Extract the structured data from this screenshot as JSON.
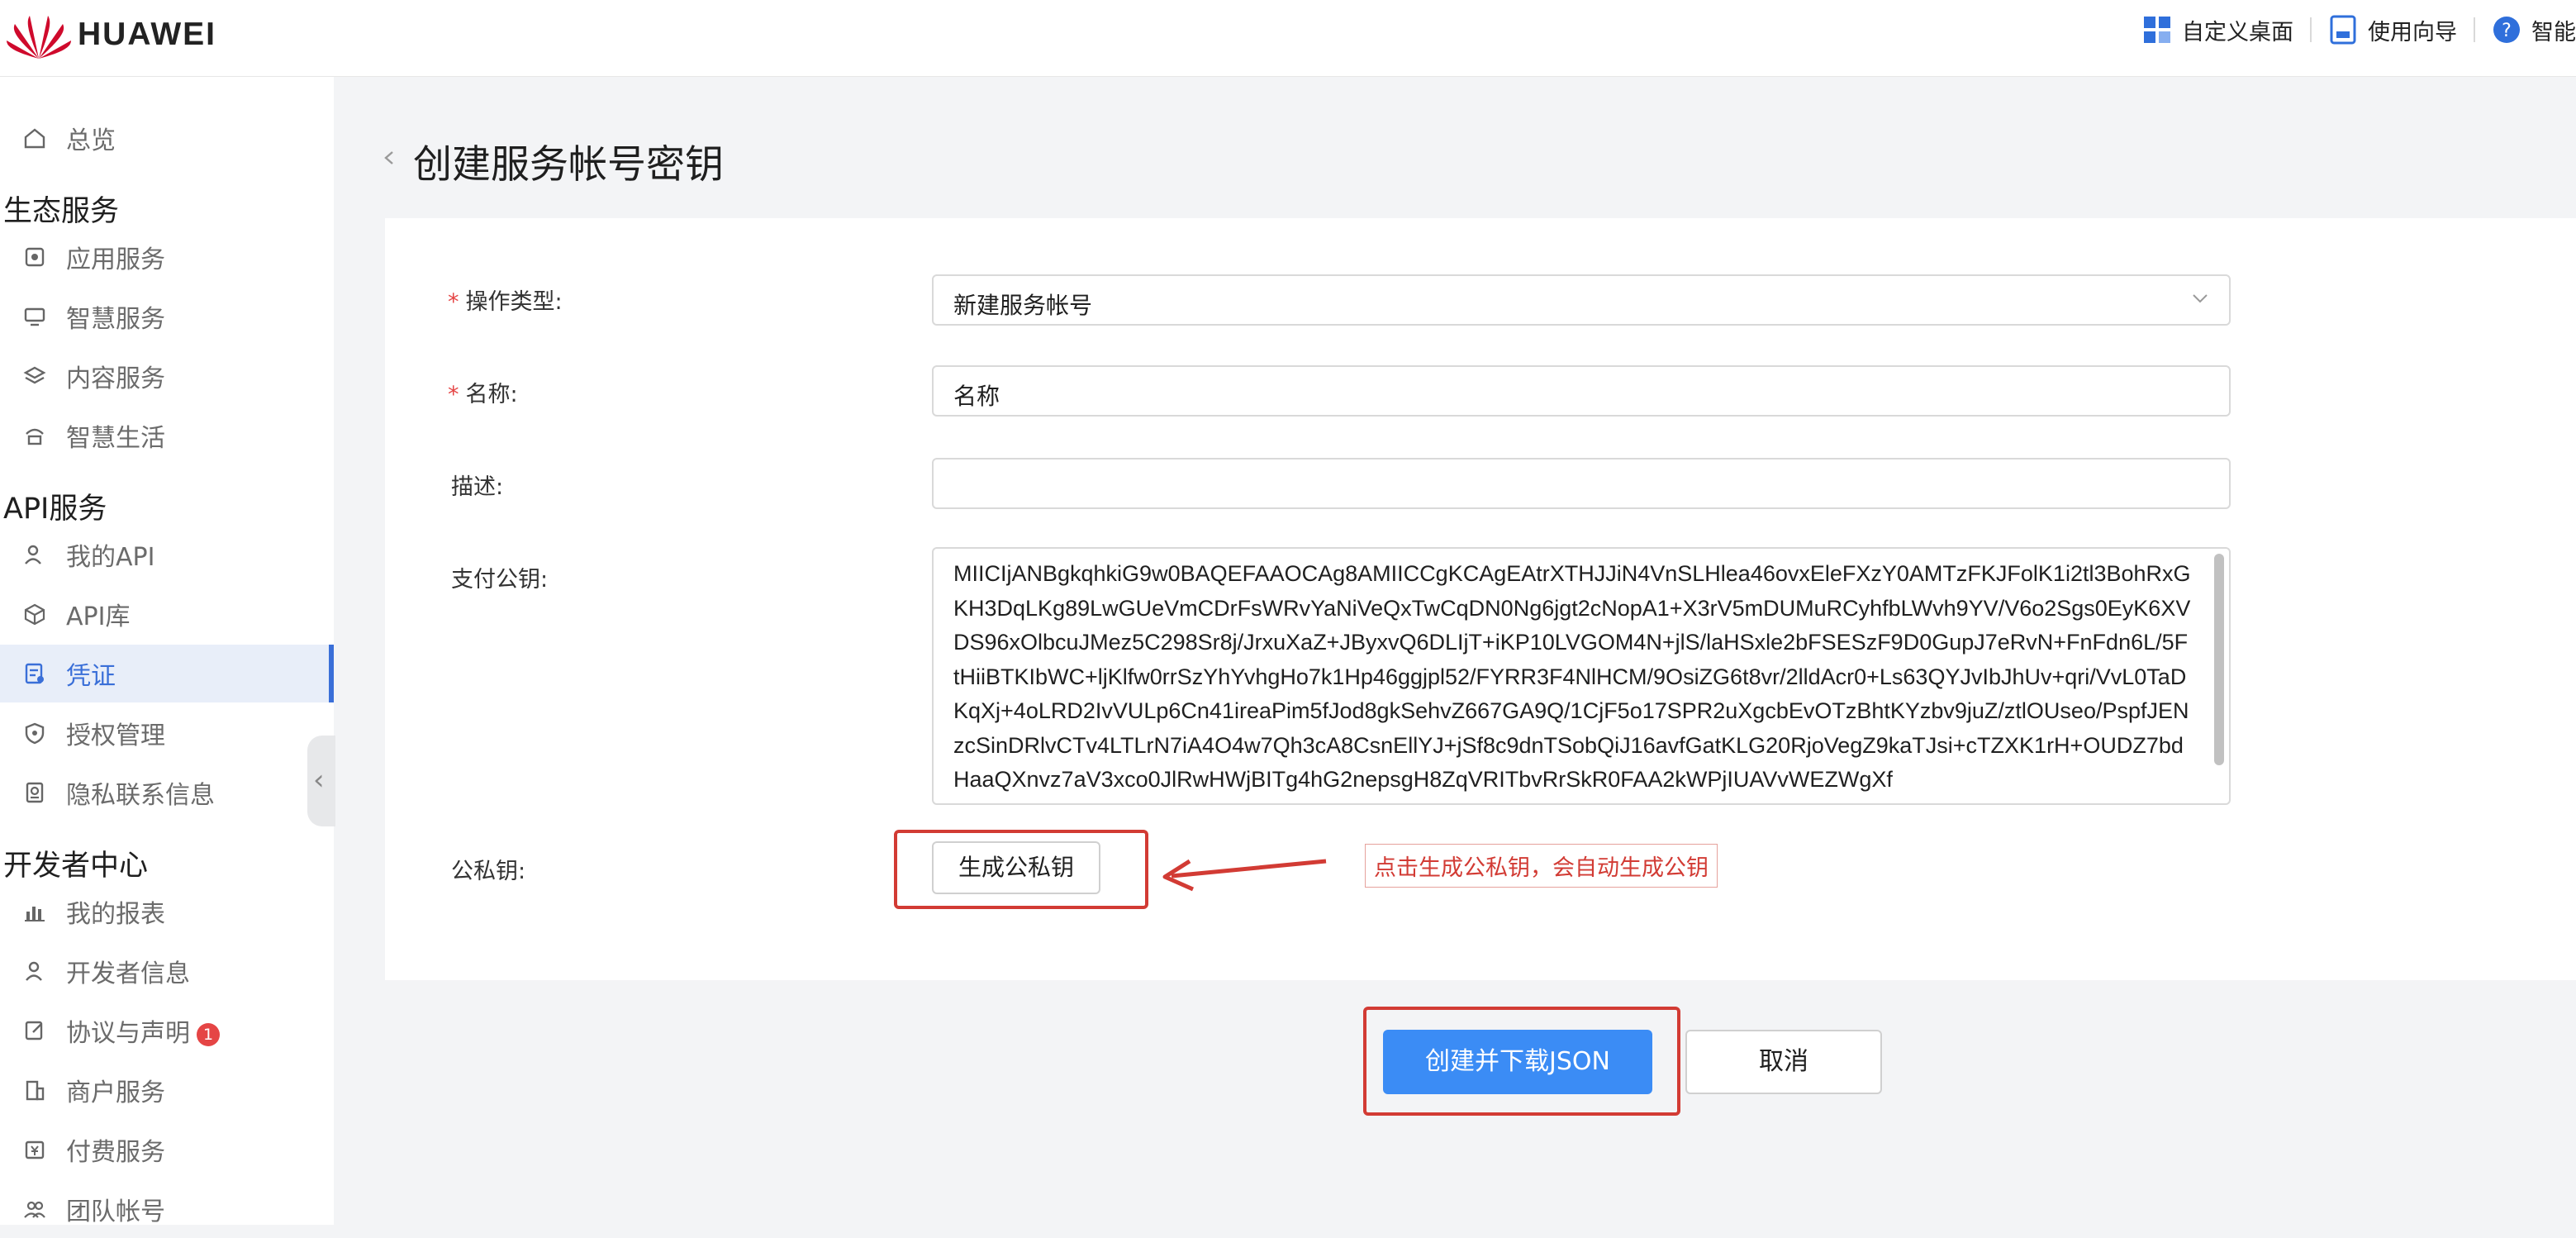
{
  "header": {
    "brand": "HUAWEI",
    "brand_color": "#cf0a2c",
    "actions": [
      {
        "label": "自定义桌面",
        "icon": "grid-icon"
      },
      {
        "label": "使用向导",
        "icon": "guide-icon"
      },
      {
        "label": "智能",
        "icon": "help-icon"
      }
    ]
  },
  "sidebar": {
    "overview": "总览",
    "sections": [
      {
        "title": "生态服务",
        "items": [
          "应用服务",
          "智慧服务",
          "内容服务",
          "智慧生活"
        ]
      },
      {
        "title": "API服务",
        "items": [
          "我的API",
          "API库",
          "凭证",
          "授权管理",
          "隐私联系信息"
        ]
      },
      {
        "title": "开发者中心",
        "items": [
          "我的报表",
          "开发者信息",
          "协议与声明",
          "商户服务",
          "付费服务",
          "团队帐号"
        ]
      }
    ],
    "active_item": "凭证",
    "agreement_badge": "1"
  },
  "page": {
    "title": "创建服务帐号密钥"
  },
  "form": {
    "operation_type_label": "操作类型:",
    "operation_type_value": "新建服务帐号",
    "name_label": "名称:",
    "name_value": "名称",
    "description_label": "描述:",
    "description_value": "",
    "payment_public_key_label": "支付公钥:",
    "payment_public_key_value": "MIICIjANBgkqhkiG9w0BAQEFAAOCAg8AMIICCgKCAgEAtrXTHJJiN4VnSLHlea46ovxEleFXzY0AMTzFKJFolK1i2tl3BohRxGKH3DqLKg89LwGUeVmCDrFsWRvYaNiVeQxTwCqDN0Ng6jgt2cNopA1+X3rV5mDUMuRCyhfbLWvh9YV/V6o2Sgs0EyK6XVDS96xOlbcuJMez5C298Sr8j/JrxuXaZ+JByxvQ6DLIjT+iKP10LVGOM4N+jlS/laHSxle2bFSESzF9D0GupJ7eRvN+FnFdn6L/5FtHiiBTKIbWC+ljKlfw0rrSzYhYvhgHo7k1Hp46ggjpl52/FYRR3F4NlHCM/9OsiZG6t8vr/2lldAcr0+Ls63QYJvIbJhUv+qri/VvL0TaDKqXj+4oLRD2IvVULp6Cn41ireaPim5fJod8gkSehvZ667GA9Q/1CjF5o17SPR2uXgcbEvOTzBhtKYzbv9juZ/ztlOUseo/PspfJENzcSinDRlvCTv4LTLrN7iA4O4w7Qh3cA8CsnEllYJ+jSf8c9dnTSobQiJ16avfGatKLG20RjoVegZ9kaTJsi+cTZXK1rH+OUDZ7bdHaaQXnvz7aV3xco0JlRwHWjBITg4hG2nepsgH8ZqVRITbvRrSkR0FAA2kWPjIUAVvWEZWgXf",
    "private_key_label": "公私钥:",
    "generate_button": "生成公私钥",
    "callout": "点击生成公私钥，会自动生成公钥",
    "annotation_color": "#d23b34"
  },
  "footer": {
    "submit_label": "创建并下载JSON",
    "cancel_label": "取消",
    "primary_color": "#3b8cf5"
  }
}
